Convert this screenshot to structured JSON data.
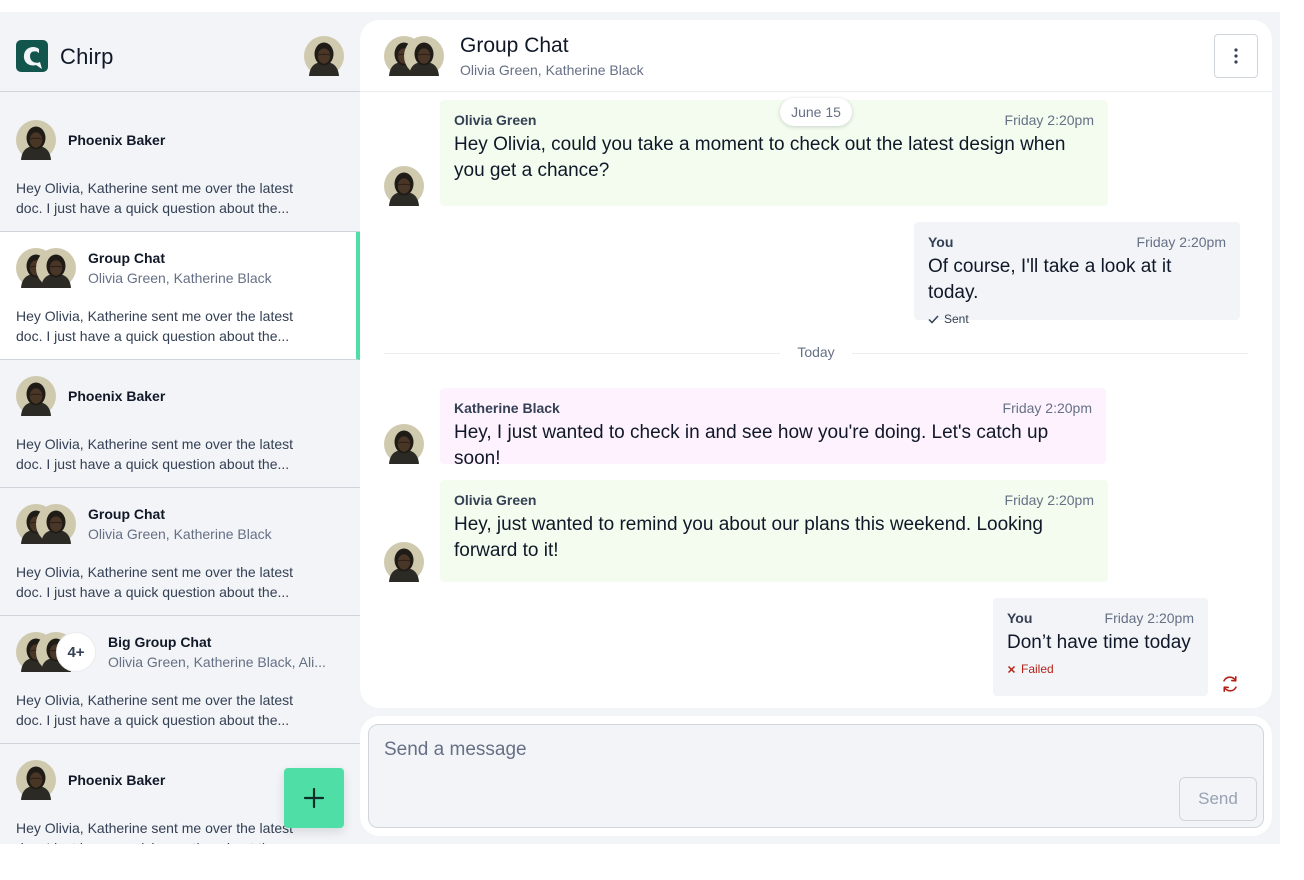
{
  "app": {
    "brand": "Chirp",
    "brand_color": "#12554c",
    "accent": "#4fdfa6"
  },
  "sidebar": {
    "conversations": [
      {
        "type": "single",
        "name": "Phoenix Baker",
        "preview": "Hey Olivia, Katherine sent me over the latest doc. I just have a quick question about the..."
      },
      {
        "type": "group",
        "name": "Group Chat",
        "members": "Olivia Green, Katherine Black",
        "preview": "Hey Olivia, Katherine sent me over the latest doc. I just have a quick question about the...",
        "active": true
      },
      {
        "type": "single",
        "name": "Phoenix Baker",
        "preview": "Hey Olivia, Katherine sent me over the latest doc. I just have a quick question about the..."
      },
      {
        "type": "group",
        "name": "Group Chat",
        "members": "Olivia Green, Katherine Black",
        "preview": "Hey Olivia, Katherine sent me over the latest doc. I just have a quick question about the..."
      },
      {
        "type": "biggroup",
        "name": "Big Group Chat",
        "members": "Olivia Green, Katherine Black, Ali...",
        "extra_count": "4+",
        "preview": "Hey Olivia, Katherine sent me over the latest doc. I just have a quick question about the..."
      },
      {
        "type": "single",
        "name": "Phoenix Baker",
        "preview": "Hey Olivia, Katherine sent me over the latest doc. I just have a quick question about the..."
      }
    ],
    "fab_icon": "plus-icon"
  },
  "chat": {
    "title": "Group Chat",
    "members": "Olivia Green, Katherine Black",
    "date_chip": "June 15",
    "divider_label": "Today",
    "messages": [
      {
        "author": "Olivia Green",
        "time": "Friday 2:20pm",
        "text": "Hey Olivia, could you take a moment to check out the latest design when you get a chance?"
      },
      {
        "author": "You",
        "time": "Friday 2:20pm",
        "text": "Of course, I'll take a look at it today.",
        "status": "Sent"
      },
      {
        "author": "Katherine Black",
        "time": "Friday 2:20pm",
        "text": "Hey, I just wanted to check in and see how you're doing. Let's catch up soon!"
      },
      {
        "author": "Olivia Green",
        "time": "Friday 2:20pm",
        "text": "Hey, just wanted to remind you about our plans this weekend. Looking forward to it!"
      },
      {
        "author": "You",
        "time": "Friday 2:20pm",
        "text": "Don’t have time today",
        "status": "Failed"
      }
    ]
  },
  "composer": {
    "placeholder": "Send a message",
    "value": "",
    "send_label": "Send"
  }
}
